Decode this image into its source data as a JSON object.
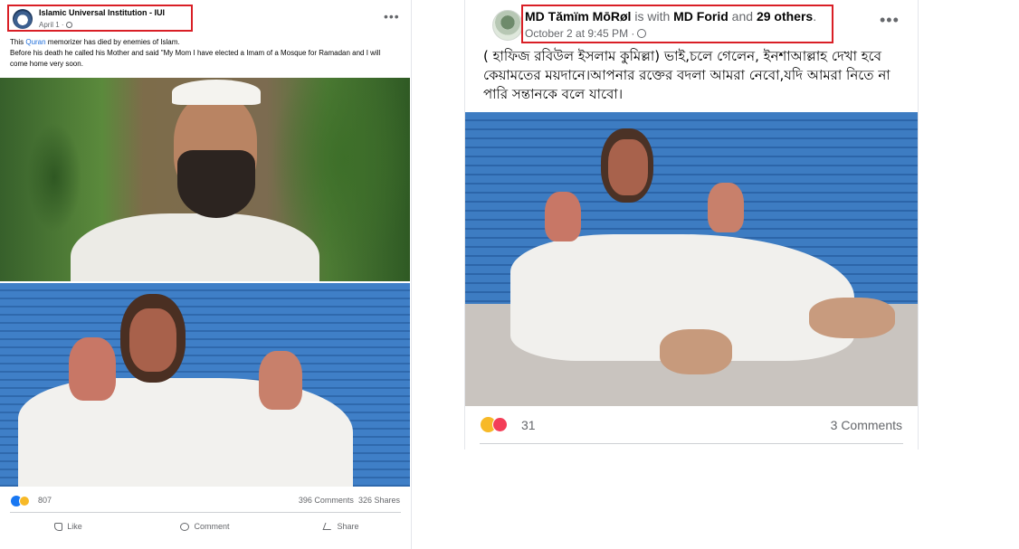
{
  "left_post": {
    "page_name": "Islamic Universal Institution - IUI",
    "date": "April 1 ·",
    "caption_prefix": "This ",
    "caption_link": "Quran",
    "caption_rest": " memorizer has died by enemies of Islam.",
    "caption_line2": "Before his death he called his Mother and said \"My Mom I have elected a Imam of a Mosque for Ramadan and I will come home very soon.",
    "reaction_count": "807",
    "comments": "396 Comments",
    "shares": "326 Shares",
    "actions": {
      "like": "Like",
      "comment": "Comment",
      "share": "Share"
    }
  },
  "right_post": {
    "author": "MD Tămïm MōRøl",
    "with_text": " is with ",
    "tagged": "MD Forid",
    "and_text": " and ",
    "others": "29 others",
    "period": ".",
    "date": "October 2 at 9:45 PM ·",
    "text": "( হাফিজ রবিউল ইসলাম কুমিল্লা) ভাই,চলে গেলেন, ইনশাআল্লাহ দেখা হবে কেয়ামতের ময়দানে।আপনার রক্তের বদলা আমরা নেবো,যদি আমরা নিতে না পারি সন্তানকে বলে যাবো।",
    "reaction_count": "31",
    "comments": "3 Comments"
  },
  "colors": {
    "highlight_border": "#d91f26",
    "link": "#216fdb",
    "secondary_text": "#65676b"
  }
}
